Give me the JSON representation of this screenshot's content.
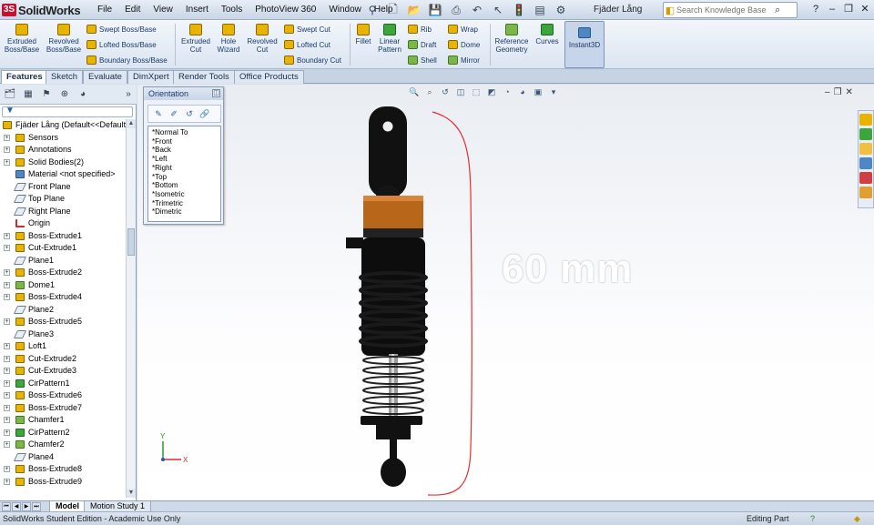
{
  "app": {
    "name": "SolidWorks",
    "logo_mark": "3S",
    "document_title": "Fjäder Lång"
  },
  "menus": [
    "File",
    "Edit",
    "View",
    "Insert",
    "Tools",
    "PhotoView 360",
    "Window",
    "Help"
  ],
  "search": {
    "placeholder": "Search Knowledge Base"
  },
  "command_manager": {
    "extruded_boss": "Extruded\nBoss/Base",
    "revolved_boss": "Revolved\nBoss/Base",
    "swept_boss": "Swept Boss/Base",
    "lofted_boss": "Lofted Boss/Base",
    "boundary_boss": "Boundary Boss/Base",
    "extruded_cut": "Extruded\nCut",
    "hole_wizard": "Hole\nWizard",
    "revolved_cut": "Revolved\nCut",
    "swept_cut": "Swept Cut",
    "lofted_cut": "Lofted Cut",
    "boundary_cut": "Boundary Cut",
    "fillet": "Fillet",
    "linear_pattern": "Linear\nPattern",
    "rib": "Rib",
    "draft": "Draft",
    "shell": "Shell",
    "wrap": "Wrap",
    "dome": "Dome",
    "mirror": "Mirror",
    "reference_geometry": "Reference\nGeometry",
    "curves": "Curves",
    "instant3d": "Instant3D"
  },
  "tabs": [
    "Features",
    "Sketch",
    "Evaluate",
    "DimXpert",
    "Render Tools",
    "Office Products"
  ],
  "feature_tree": {
    "root": "Fjäder Lång  (Default<<Default",
    "items": [
      "Sensors",
      "Annotations",
      "Solid Bodies(2)",
      "Material <not specified>",
      "Front Plane",
      "Top Plane",
      "Right Plane",
      "Origin",
      "Boss-Extrude1",
      "Cut-Extrude1",
      "Plane1",
      "Boss-Extrude2",
      "Dome1",
      "Boss-Extrude4",
      "Plane2",
      "Boss-Extrude5",
      "Plane3",
      "Loft1",
      "Cut-Extrude2",
      "Cut-Extrude3",
      "CirPattern1",
      "Boss-Extrude6",
      "Boss-Extrude7",
      "Chamfer1",
      "CirPattern2",
      "Chamfer2",
      "Plane4",
      "Boss-Extrude8",
      "Boss-Extrude9"
    ]
  },
  "orientation": {
    "title": "Orientation",
    "views": [
      "*Normal To",
      "*Front",
      "*Back",
      "*Left",
      "*Right",
      "*Top",
      "*Bottom",
      "*Isometric",
      "*Trimetric",
      "*Dimetric"
    ]
  },
  "viewport": {
    "annotation": "60 mm",
    "triad_x": "X",
    "triad_y": "Y",
    "annotation_color": "#e83030"
  },
  "bottom_tabs": [
    "Model",
    "Motion Study 1"
  ],
  "status": {
    "left": "SolidWorks Student Edition - Academic Use Only",
    "mode": "Editing Part"
  },
  "colors": {
    "accent_orange": "#b8661a",
    "part_black": "#111111"
  }
}
